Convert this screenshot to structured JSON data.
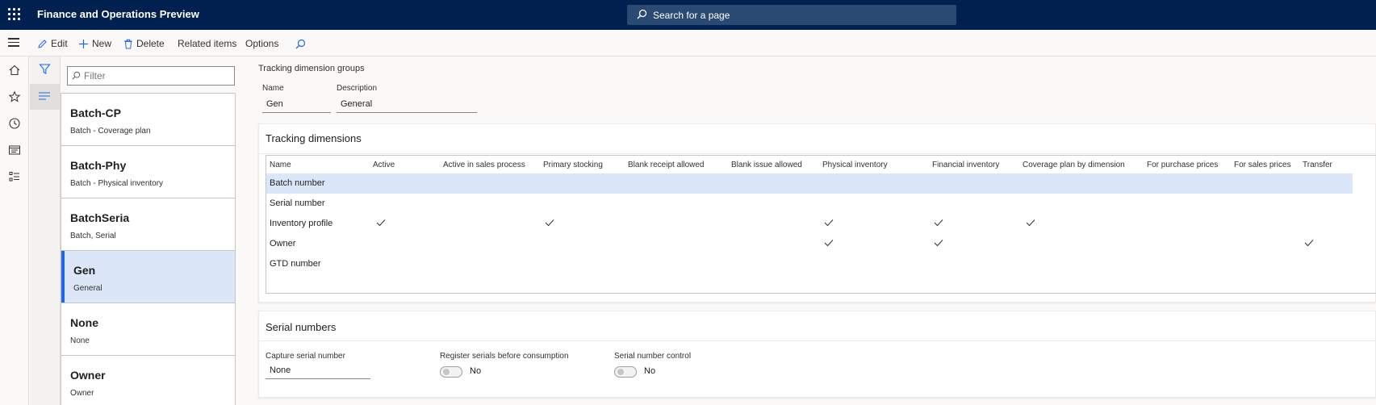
{
  "app": {
    "title": "Finance and Operations Preview"
  },
  "search": {
    "placeholder": "Search for a page"
  },
  "actions": {
    "edit": "Edit",
    "new": "New",
    "delete": "Delete",
    "related": "Related items",
    "options": "Options"
  },
  "list": {
    "filter_placeholder": "Filter",
    "items": [
      {
        "name": "Batch-CP",
        "description": "Batch - Coverage plan"
      },
      {
        "name": "Batch-Phy",
        "description": "Batch - Physical inventory"
      },
      {
        "name": "BatchSeria",
        "description": "Batch, Serial"
      },
      {
        "name": "Gen",
        "description": "General"
      },
      {
        "name": "None",
        "description": "None"
      },
      {
        "name": "Owner",
        "description": "Owner"
      }
    ],
    "selected_index": 3
  },
  "detail": {
    "breadcrumb": "Tracking dimension groups",
    "name_label": "Name",
    "name_value": "Gen",
    "description_label": "Description",
    "description_value": "General"
  },
  "tracking": {
    "title": "Tracking dimensions",
    "columns": [
      "Name",
      "Active",
      "Active in sales process",
      "Primary stocking",
      "Blank receipt allowed",
      "Blank issue allowed",
      "Physical inventory",
      "Financial inventory",
      "Coverage plan by dimension",
      "For purchase prices",
      "For sales prices",
      "Transfer"
    ],
    "rows": [
      {
        "name": "Batch number",
        "active": false,
        "active_sales": false,
        "primary": false,
        "blank_receipt": false,
        "blank_issue": false,
        "physical": false,
        "financial": false,
        "coverage": false,
        "purchase": false,
        "sales": false,
        "transfer": false
      },
      {
        "name": "Serial number",
        "active": false,
        "active_sales": false,
        "primary": false,
        "blank_receipt": false,
        "blank_issue": false,
        "physical": false,
        "financial": false,
        "coverage": false,
        "purchase": false,
        "sales": false,
        "transfer": false
      },
      {
        "name": "Inventory profile",
        "active": true,
        "active_sales": false,
        "primary": true,
        "blank_receipt": false,
        "blank_issue": false,
        "physical": true,
        "financial": true,
        "coverage": true,
        "purchase": false,
        "sales": false,
        "transfer": false
      },
      {
        "name": "Owner",
        "active": false,
        "active_sales": false,
        "primary": false,
        "blank_receipt": false,
        "blank_issue": false,
        "physical": true,
        "financial": true,
        "coverage": false,
        "purchase": false,
        "sales": false,
        "transfer": true
      },
      {
        "name": "GTD number",
        "active": false,
        "active_sales": false,
        "primary": false,
        "blank_receipt": false,
        "blank_issue": false,
        "physical": false,
        "financial": false,
        "coverage": false,
        "purchase": false,
        "sales": false,
        "transfer": false
      }
    ],
    "selected_row": 0
  },
  "serial": {
    "title": "Serial numbers",
    "capture_label": "Capture serial number",
    "capture_value": "None",
    "register_label": "Register serials before consumption",
    "register_value": "No",
    "control_label": "Serial number control",
    "control_value": "No"
  },
  "colors": {
    "topbar": "#002050",
    "accent": "#2266e3",
    "selected": "#dbe6f8"
  }
}
